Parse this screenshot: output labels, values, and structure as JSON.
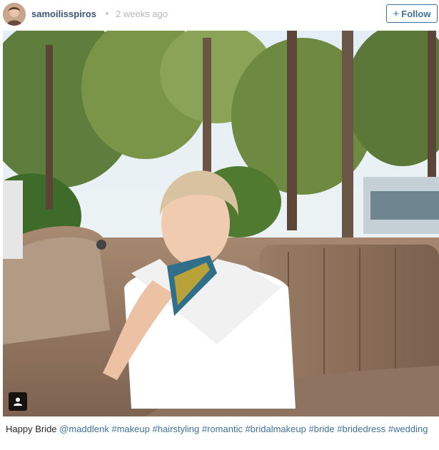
{
  "header": {
    "username": "samoilisspiros",
    "separator": "•",
    "time_ago": "2 weeks ago",
    "follow_plus": "+",
    "follow_label": "Follow"
  },
  "post": {
    "photo_icon": "user-tag-icon"
  },
  "caption": {
    "text": "Happy Bride",
    "mention": "@maddlenk",
    "hashtags": [
      "#makeup",
      "#hairstyling",
      "#romantic",
      "#bridalmakeup",
      "#bride",
      "#bridedress",
      "#wedding"
    ]
  },
  "colors": {
    "link": "#3f729b",
    "username": "#3b5675",
    "muted": "#b8b8b8"
  }
}
